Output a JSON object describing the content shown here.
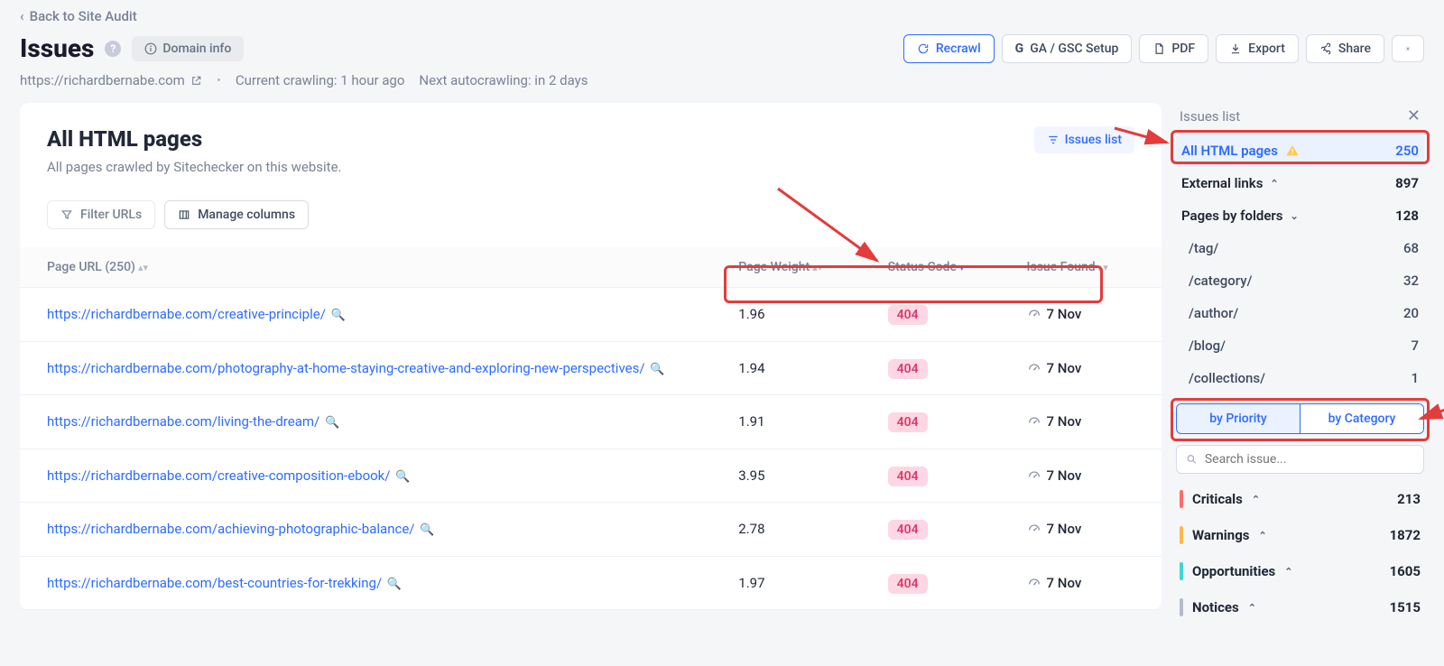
{
  "back_link": "Back to Site Audit",
  "title": "Issues",
  "domain_info_btn": "Domain info",
  "site_url": "https://richardbernabe.com",
  "crawl_status": "Current crawling: 1 hour ago",
  "next_crawl": "Next autocrawling: in 2 days",
  "toolbar": {
    "recrawl": "Recrawl",
    "ga_gsc": "GA / GSC Setup",
    "pdf": "PDF",
    "export": "Export",
    "share": "Share"
  },
  "main": {
    "title": "All HTML pages",
    "subtitle": "All pages crawled by Sitechecker on this website.",
    "issues_list_btn": "Issues list",
    "filter_urls": "Filter URLs",
    "manage_cols": "Manage columns"
  },
  "cols": {
    "url": "Page URL (250)",
    "weight": "Page Weight",
    "status": "Status Code",
    "issue": "Issue Found"
  },
  "rows": [
    {
      "url": "https://richardbernabe.com/creative-principle/",
      "weight": "1.96",
      "status": "404",
      "date": "7 Nov"
    },
    {
      "url": "https://richardbernabe.com/photography-at-home-staying-creative-and-exploring-new-perspectives/",
      "weight": "1.94",
      "status": "404",
      "date": "7 Nov"
    },
    {
      "url": "https://richardbernabe.com/living-the-dream/",
      "weight": "1.91",
      "status": "404",
      "date": "7 Nov"
    },
    {
      "url": "https://richardbernabe.com/creative-composition-ebook/",
      "weight": "3.95",
      "status": "404",
      "date": "7 Nov"
    },
    {
      "url": "https://richardbernabe.com/achieving-photographic-balance/",
      "weight": "2.78",
      "status": "404",
      "date": "7 Nov"
    },
    {
      "url": "https://richardbernabe.com/best-countries-for-trekking/",
      "weight": "1.97",
      "status": "404",
      "date": "7 Nov"
    }
  ],
  "side": {
    "title": "Issues list",
    "all_html": {
      "label": "All HTML pages",
      "count": "250"
    },
    "external": {
      "label": "External links",
      "count": "897"
    },
    "folders_head": {
      "label": "Pages by folders",
      "count": "128"
    },
    "folders": [
      {
        "label": "/tag/",
        "count": "68"
      },
      {
        "label": "/category/",
        "count": "32"
      },
      {
        "label": "/author/",
        "count": "20"
      },
      {
        "label": "/blog/",
        "count": "7"
      },
      {
        "label": "/collections/",
        "count": "1"
      }
    ],
    "seg_priority": "by Priority",
    "seg_category": "by Category",
    "search_placeholder": "Search issue...",
    "severities": [
      {
        "label": "Criticals",
        "count": "213",
        "cls": "sev-crit"
      },
      {
        "label": "Warnings",
        "count": "1872",
        "cls": "sev-warn"
      },
      {
        "label": "Opportunities",
        "count": "1605",
        "cls": "sev-opp"
      },
      {
        "label": "Notices",
        "count": "1515",
        "cls": "sev-not"
      }
    ]
  }
}
